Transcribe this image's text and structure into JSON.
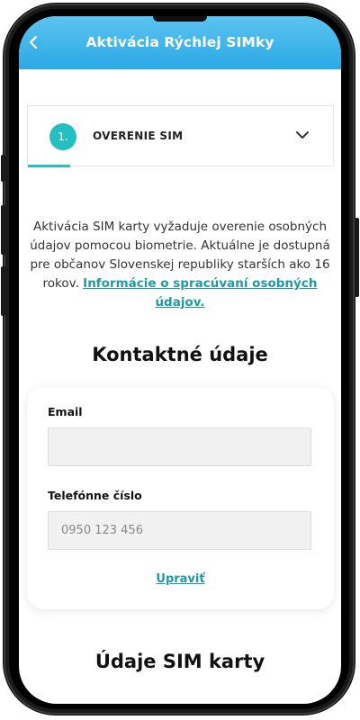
{
  "header": {
    "title": "Aktivácia Rýchlej SIMky",
    "back_icon": "chevron-left-icon"
  },
  "step": {
    "number": "1.",
    "label": "OVERENIE SIM",
    "toggle_icon": "chevron-down-icon"
  },
  "description": {
    "text": "Aktivácia SIM karty vyžaduje overenie osobných údajov pomocou biometrie. Aktuálne je dostupná pre občanov Slovenskej republiky starších ako 16 rokov. ",
    "link": "Informácie o spracúvaní osobných údajov."
  },
  "contact": {
    "title": "Kontaktné údaje",
    "email_label": "Email",
    "email_value": "",
    "phone_label": "Telefónne číslo",
    "phone_placeholder": "0950 123 456",
    "edit_label": "Upraviť"
  },
  "sim": {
    "title": "Údaje SIM karty"
  },
  "colors": {
    "accent": "#24bfc1",
    "link": "#1f9aa5",
    "header_top": "#5cc3ef",
    "header_bottom": "#2aa9e6"
  }
}
